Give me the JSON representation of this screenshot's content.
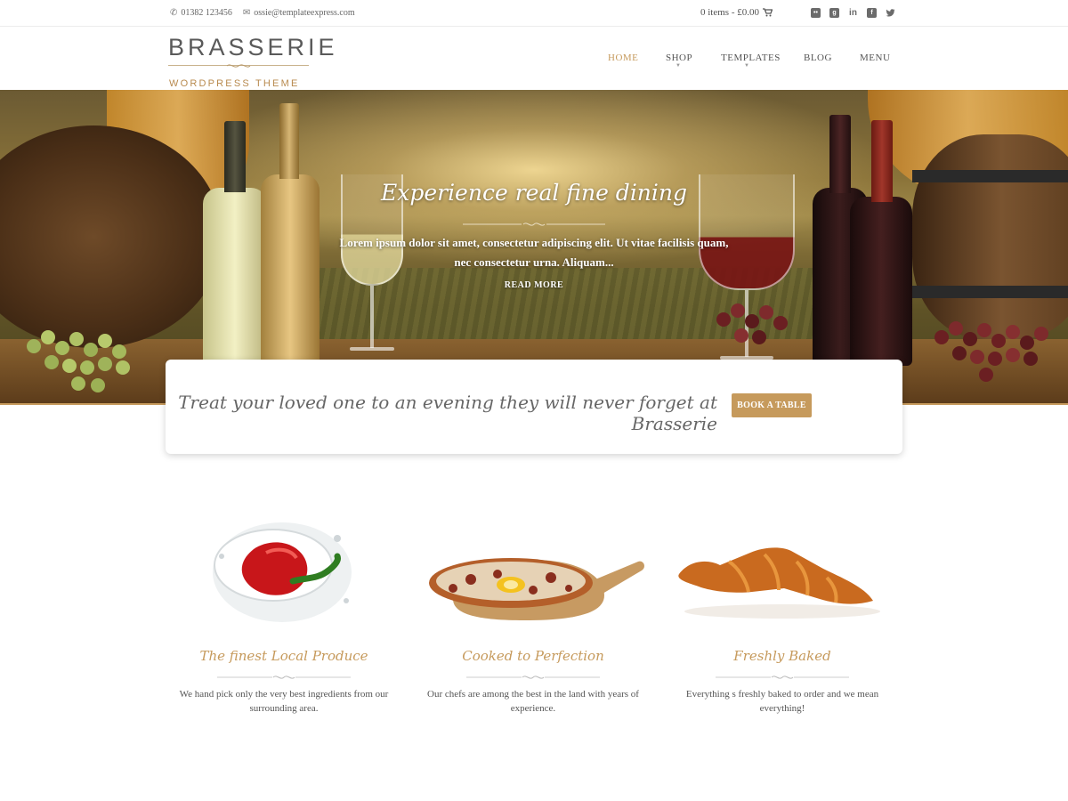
{
  "topbar": {
    "phone": "01382 123456",
    "email": "ossie@templateexpress.com",
    "cart": "0 items - £0.00",
    "social": [
      "flickr-icon",
      "google-plus-icon",
      "linkedin-icon",
      "facebook-icon",
      "twitter-icon"
    ]
  },
  "logo": {
    "name": "BRASSERIE",
    "tagline": "WORDPRESS THEME"
  },
  "nav": {
    "items": [
      "HOME",
      "SHOP",
      "TEMPLATES",
      "BLOG",
      "MENU"
    ],
    "active": "HOME"
  },
  "hero": {
    "title": "Experience real fine dining",
    "text": "Lorem ipsum dolor sit amet, consectetur adipiscing elit. Ut vitae facilisis quam, nec consectetur urna. Aliquam...",
    "read_more": "READ MORE"
  },
  "booking": {
    "text": "Treat your loved one to an evening they will never forget at Brasserie",
    "button": "BOOK A TABLE"
  },
  "features": [
    {
      "title": "The finest Local Produce",
      "desc": "We hand pick only the very best ingredients from our surrounding area.",
      "image": "red-pepper"
    },
    {
      "title": "Cooked to Perfection",
      "desc": "Our chefs are among the best in the land with years of experience.",
      "image": "pizza"
    },
    {
      "title": "Freshly Baked",
      "desc": "Everything s freshly baked to order and we mean everything!",
      "image": "croissant"
    }
  ],
  "colors": {
    "accent": "#c69a5c",
    "text": "#555555"
  }
}
